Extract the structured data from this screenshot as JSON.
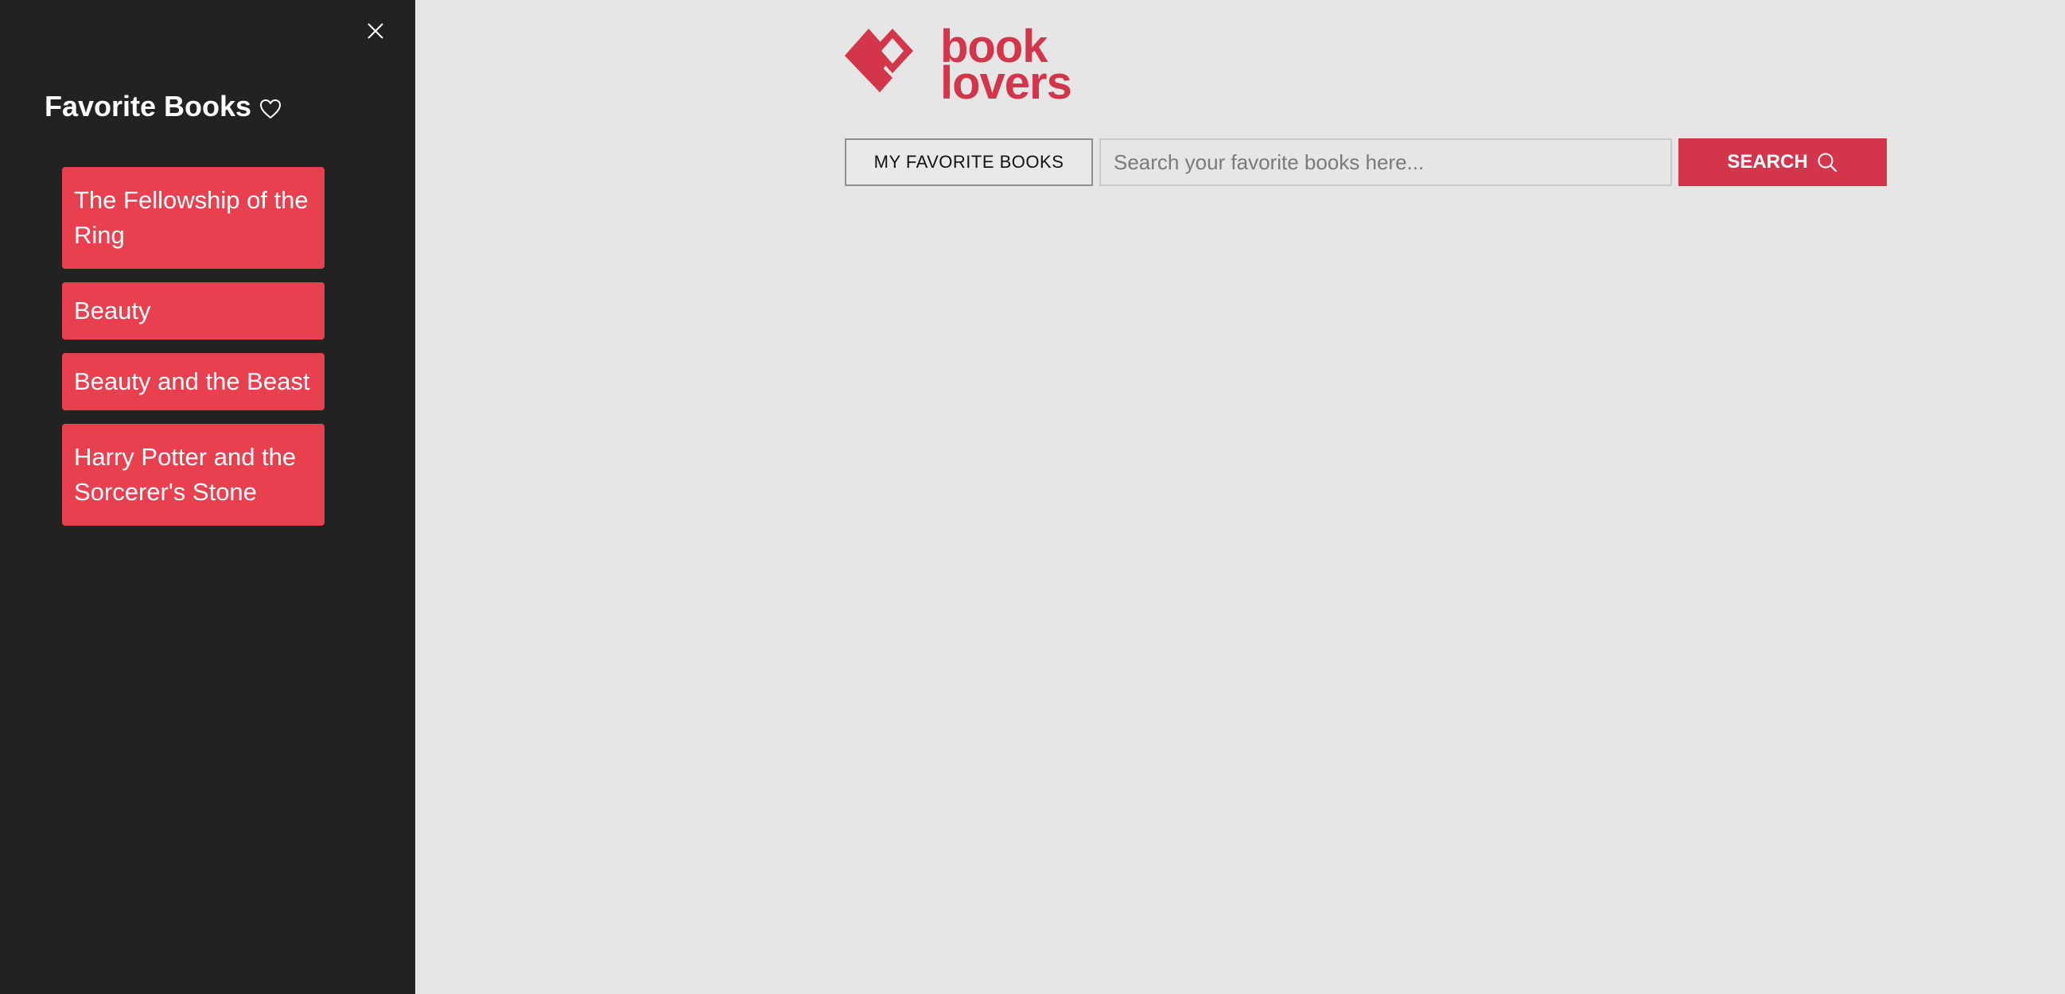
{
  "sidebar": {
    "title": "Favorite Books",
    "title_icon": "heart-outline-icon",
    "close_icon": "close-icon",
    "items": [
      {
        "label": "The Fellowship of the Ring"
      },
      {
        "label": "Beauty"
      },
      {
        "label": "Beauty and the Beast"
      },
      {
        "label": "Harry Potter and the Sorcerer's Stone"
      }
    ]
  },
  "header": {
    "logo_line1": "book",
    "logo_line2": "lovers",
    "logo_icon": "heart-book-logo-icon"
  },
  "toolbar": {
    "favorites_label": "MY FAVORITE BOOKS",
    "search_placeholder": "Search your favorite books here...",
    "search_value": "",
    "search_button_label": "SEARCH",
    "search_icon": "search-icon"
  },
  "colors": {
    "brand": "#d3364a",
    "item_bg": "#e8404f",
    "sidebar_bg": "#222222",
    "page_bg": "#e6e6e6"
  }
}
